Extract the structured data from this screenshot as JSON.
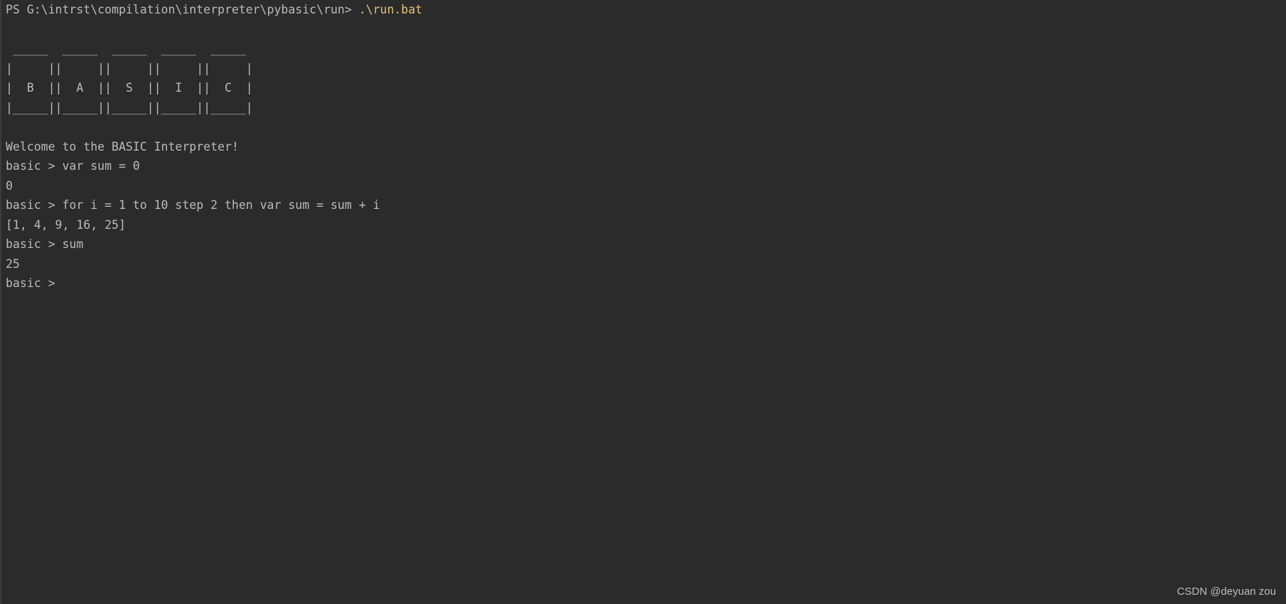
{
  "terminal": {
    "ps_prompt": "PS G:\\intrst\\compilation\\interpreter\\pybasic\\run> ",
    "ps_command": ".\\run.bat",
    "banner": [
      " _____  _____  _____  _____  _____",
      "|     ||     ||     ||     ||     |",
      "|  B  ||  A  ||  S  ||  I  ||  C  |",
      "|_____||_____||_____||_____||_____|"
    ],
    "welcome": "Welcome to the BASIC Interpreter!",
    "session": [
      "basic > var sum = 0",
      "0",
      "basic > for i = 1 to 10 step 2 then var sum = sum + i",
      "[1, 4, 9, 16, 25]",
      "basic > sum",
      "25",
      "basic > "
    ]
  },
  "watermark": "CSDN @deyuan zou",
  "colors": {
    "background": "#2b2b2b",
    "text": "#bbbbbb",
    "command_highlight": "#e5c07b"
  }
}
